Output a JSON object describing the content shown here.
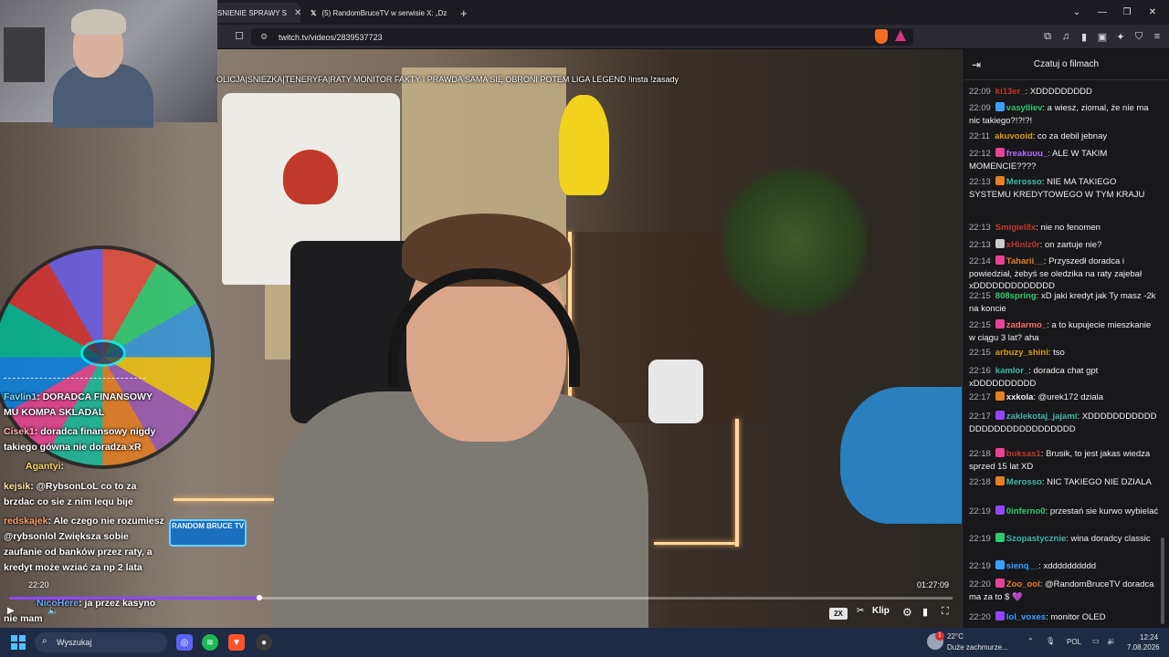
{
  "browser": {
    "tabs": [
      {
        "label": "SNIENIE SPRAWY S",
        "active": true
      },
      {
        "label": "(5) RandomBruceTV w serwisie X: „Dz",
        "active": false
      }
    ],
    "url": "twitch.tv/videos/2839537723",
    "window_controls": [
      "⌄",
      "—",
      "❐",
      "✕"
    ]
  },
  "video": {
    "title": "OLICJA|SNIEZKA|TENERYFA|RATY MONITOR FAKTY I PRAWDA SAMA SIĘ OBRONI POTEM LIGA LEGEND !insta !zasady",
    "overlay_timestamp": "22:20",
    "elapsed": "01:27:09",
    "progress": 0.265,
    "speed": "2X",
    "clip_label": "Klip",
    "sign_text": "RANDOM BRUCE TV",
    "overlay_chat": [
      {
        "user": "Favlin1",
        "text": ": DORADCA FINANSOWY MU KOMPA SKLADAL",
        "color": "#8be0ff"
      },
      {
        "user": "Cisek1",
        "text": ": doradca finansowy nigdy takiego gówna nie doradza xR",
        "color": "#ffb0b0"
      },
      {
        "user": "Agantyi",
        "text": ":",
        "color": "#ffd86b"
      },
      {
        "user": "kejsik",
        "text": ": @RybsonLoL co to za brzdac co sie z nim lequ bije",
        "color": "#ffe4a3"
      },
      {
        "user": "redskajek",
        "text": ": Ale czego nie rozumiesz @rybsonlol Zwiększa sobie zaufanie od banków przez raty, a kredyt może wziać za np 2 lata",
        "color": "#ff9f6b"
      },
      {
        "user": "NicoHere",
        "text": ": ja przez kasyno nie mam",
        "color": "#6ba8ff"
      }
    ]
  },
  "chat": {
    "header": "Czatuj o filmach",
    "messages": [
      {
        "time": "22:09",
        "user": "ki13er_",
        "color": "#c0392b",
        "text": ": XDDDDDDDDD",
        "badge": ""
      },
      {
        "time": "22:09",
        "user": "vasylliev",
        "color": "#2ecc71",
        "text": ": a wiesz, ziomal, że nie ma nic takiego?!?!?!",
        "badge": "#3aa0ff"
      },
      {
        "time": "22:11",
        "user": "akuvooid",
        "color": "#d4a017",
        "text": ": co za debil jebnay",
        "badge": ""
      },
      {
        "time": "22:12",
        "user": "freakuuu_",
        "color": "#b56cff",
        "text": ": ALE W TAKIM MOMENCIE????",
        "badge": "#e84393"
      },
      {
        "time": "22:13",
        "user": "Merosso",
        "color": "#3fb6a8",
        "text": ": NIE MA TAKIEGO SYSTEMU KREDYTOWEGO W TYM KRAJU",
        "badge": "#e67e22"
      },
      {
        "time": "22:13",
        "user": "Smigiel8x",
        "color": "#c0392b",
        "text": ": nie no fenomen",
        "badge": ""
      },
      {
        "time": "22:13",
        "user": "xHinlz0r",
        "color": "#c0392b",
        "text": ": on zartuje nie?",
        "badge": "#cccccc"
      },
      {
        "time": "22:14",
        "user": "Taharii__",
        "color": "#e67e22",
        "text": ": Przyszedł doradca i powiedział, żebyś se oledzika na raty zajebał xDDDDDDDDDDDDD",
        "badge": "#e84393"
      },
      {
        "time": "22:15",
        "user": "808spring",
        "color": "#2ecc71",
        "text": ": xD jaki kredyt jak Ty masz -2k na koncie",
        "badge": ""
      },
      {
        "time": "22:15",
        "user": "zadarmo_",
        "color": "#ff6b6b",
        "text": ": a to kupujecie mieszkanie w ciągu 3 lat? aha",
        "badge": "#e84393"
      },
      {
        "time": "22:15",
        "user": "arbuzy_shini",
        "color": "#d4a017",
        "text": ": tso",
        "badge": ""
      },
      {
        "time": "22:16",
        "user": "kamlor_",
        "color": "#3fb6a8",
        "text": ": doradca chat gpt xDDDDDDDDDD",
        "badge": ""
      },
      {
        "time": "22:17",
        "user": "xxkola",
        "color": "#efeff1",
        "text": ": @urek172 dziala",
        "badge": "#e67e22"
      },
      {
        "time": "22:17",
        "user": "zaklekotaj_jajami",
        "color": "#3fb6a8",
        "text": ": XDDDDDDDDDDD DDDDDDDDDDDDDDDDD",
        "badge": "#9147ff"
      },
      {
        "time": "22:18",
        "user": "buksas1",
        "color": "#c0392b",
        "text": ": Brusik, to jest jakas wiedza sprzed 15 lat XD",
        "badge": "#e84393"
      },
      {
        "time": "22:18",
        "user": "Merosso",
        "color": "#3fb6a8",
        "text": ": NIC TAKIEGO NIE DZIALA",
        "badge": "#e67e22"
      },
      {
        "time": "22:19",
        "user": "0inferno0",
        "color": "#2ecc71",
        "text": ": przestań sie kurwo wybielać",
        "badge": "#9147ff"
      },
      {
        "time": "22:19",
        "user": "Szopastycznie",
        "color": "#3fb6a8",
        "text": ": wina doradcy classic",
        "badge": "#2ecc71"
      },
      {
        "time": "22:19",
        "user": "sienq__",
        "color": "#3aa0ff",
        "text": ": xdddddddddd",
        "badge": "#3aa0ff"
      },
      {
        "time": "22:20",
        "user": "Zoo_ool",
        "color": "#e67e22",
        "text": ": @RandomBruceTV doradca ma za to $ 💜",
        "badge": "#e84393"
      },
      {
        "time": "22:20",
        "user": "lol_voxes",
        "color": "#3aa0ff",
        "text": ": monitor OLED",
        "badge": "#9147ff"
      }
    ]
  },
  "taskbar": {
    "search_placeholder": "Wyszukaj",
    "weather_temp": "22°C",
    "weather_text": "Duże zachmurze...",
    "language": "POL",
    "time": "12:24",
    "date": "7.08.2026",
    "notification_count": "1"
  }
}
